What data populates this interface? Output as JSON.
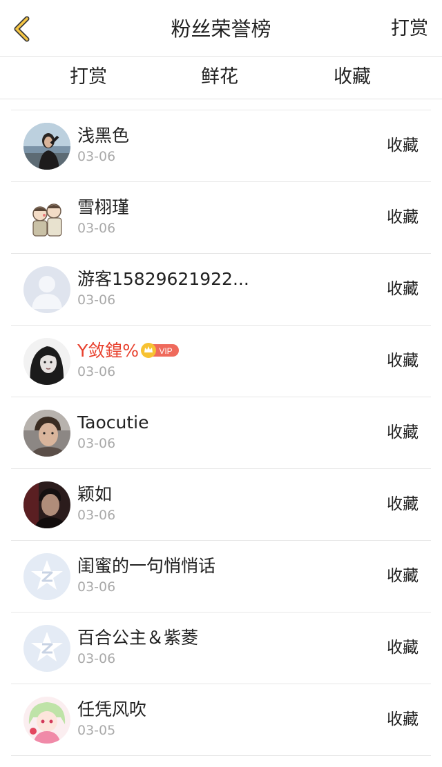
{
  "header": {
    "title": "粉丝荣誉榜",
    "right_action": "打赏"
  },
  "tabs": [
    {
      "label": "打赏",
      "active": false
    },
    {
      "label": "鲜花",
      "active": false
    },
    {
      "label": "收藏",
      "active": true
    }
  ],
  "colors": {
    "accent": "#f5a623",
    "vip_name": "#e8412e",
    "muted": "#aaaaaa",
    "divider": "#e6e6e6"
  },
  "fans": [
    {
      "name": "浅黑色",
      "date": "03-06",
      "action": "收藏",
      "avatar": "photo-woman-seaside"
    },
    {
      "name": "雪栩瑾",
      "date": "03-06",
      "action": "收藏",
      "avatar": "cartoon-couple"
    },
    {
      "name": "游客15829621922...",
      "date": "03-06",
      "action": "收藏",
      "avatar": "default-person"
    },
    {
      "name": "Y敛鍠%",
      "date": "03-06",
      "action": "收藏",
      "avatar": "photo-woman-bw",
      "vip": true,
      "vip_label": "VIP"
    },
    {
      "name": "Taocutie",
      "date": "03-06",
      "action": "收藏",
      "avatar": "photo-man"
    },
    {
      "name": "颖如",
      "date": "03-06",
      "action": "收藏",
      "avatar": "photo-man-dark"
    },
    {
      "name": "闺蜜的一句悄悄话",
      "date": "03-06",
      "action": "收藏",
      "avatar": "default-star"
    },
    {
      "name": "百合公主＆紫菱",
      "date": "03-06",
      "action": "收藏",
      "avatar": "default-star"
    },
    {
      "name": "任凭风吹",
      "date": "03-05",
      "action": "收藏",
      "avatar": "anime-girl"
    }
  ]
}
